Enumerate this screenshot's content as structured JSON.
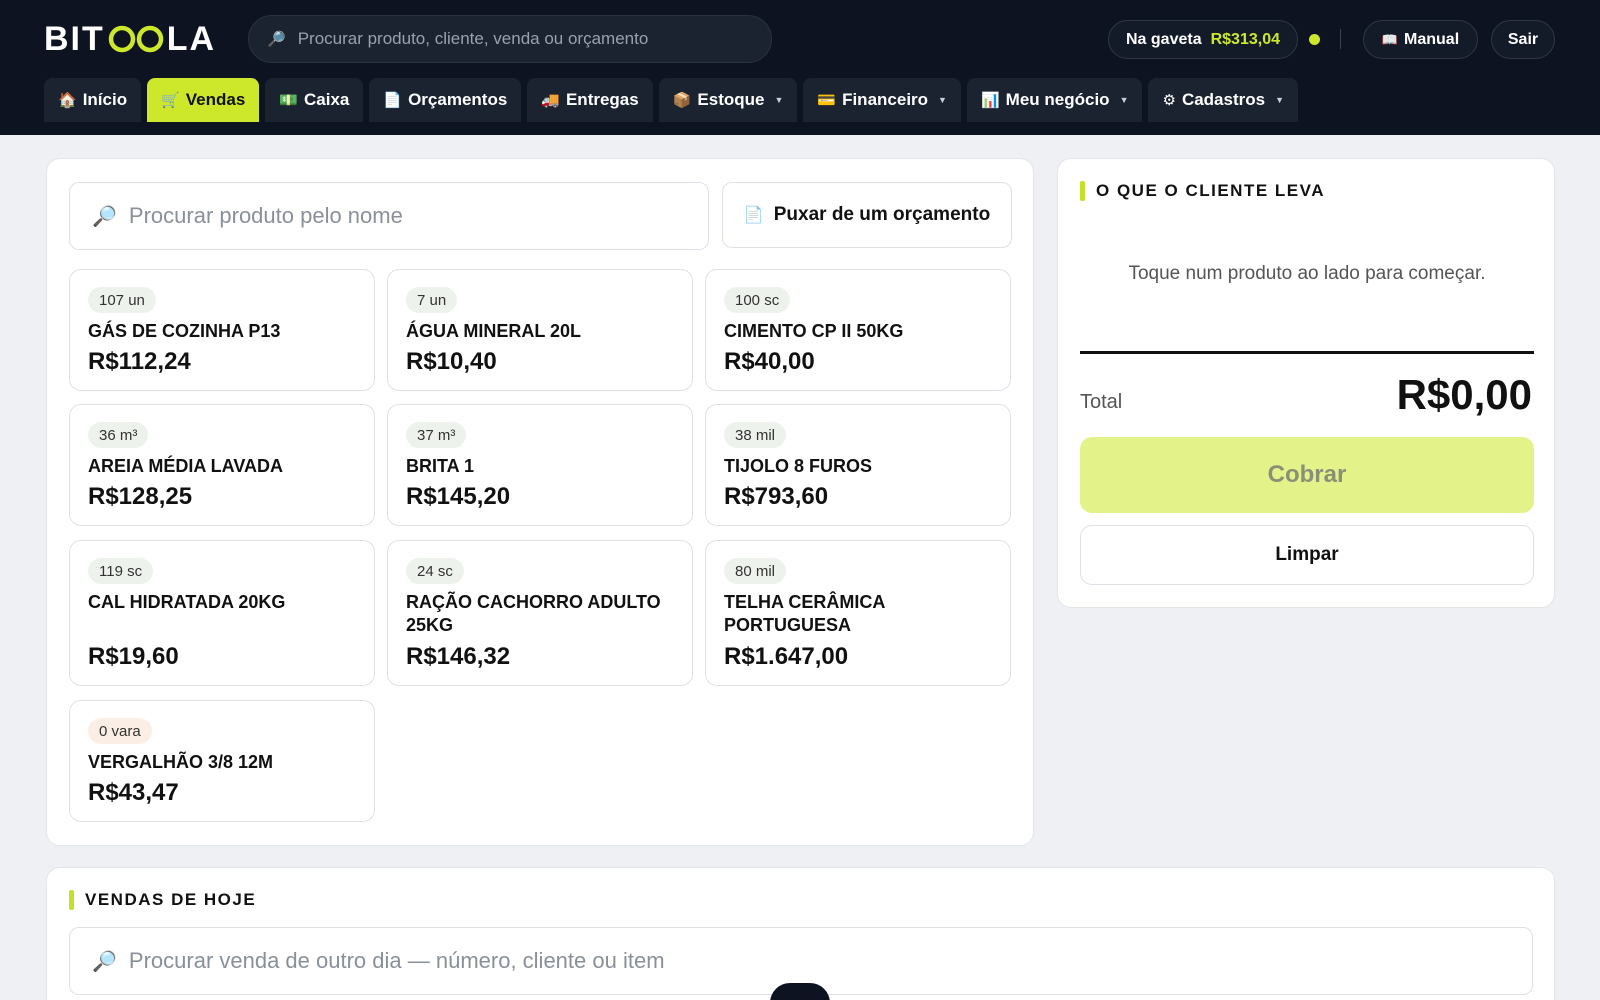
{
  "brand": {
    "name_left": "BIT",
    "name_right": "LA",
    "accent": "#cde82a",
    "header_bg": "#0d1320"
  },
  "header": {
    "search_placeholder": "Procurar produto, cliente, venda ou orçamento",
    "drawer_label": "Na gaveta",
    "drawer_amount": "R$313,04",
    "manual_label": "Manual",
    "logout_label": "Sair"
  },
  "nav": {
    "tabs": [
      {
        "icon": "🏠",
        "label": "Início"
      },
      {
        "icon": "🛒",
        "label": "Vendas"
      },
      {
        "icon": "💵",
        "label": "Caixa"
      },
      {
        "icon": "📄",
        "label": "Orçamentos"
      },
      {
        "icon": "🚚",
        "label": "Entregas"
      },
      {
        "icon": "📦",
        "label": "Estoque"
      },
      {
        "icon": "💳",
        "label": "Financeiro"
      },
      {
        "icon": "📊",
        "label": "Meu negócio"
      },
      {
        "icon": "⚙",
        "label": "Cadastros"
      }
    ],
    "active": "Vendas"
  },
  "products": {
    "search_placeholder": "Procurar produto pelo nome",
    "quote_button": "Puxar de um orçamento",
    "items": [
      {
        "stock": "107 un",
        "name": "GÁS DE COZINHA P13",
        "price": "R$112,24"
      },
      {
        "stock": "7 un",
        "name": "ÁGUA MINERAL 20L",
        "price": "R$10,40"
      },
      {
        "stock": "100 sc",
        "name": "CIMENTO CP II 50KG",
        "price": "R$40,00"
      },
      {
        "stock": "36 m³",
        "name": "AREIA MÉDIA LAVADA",
        "price": "R$128,25"
      },
      {
        "stock": "37 m³",
        "name": "BRITA 1",
        "price": "R$145,20"
      },
      {
        "stock": "38 mil",
        "name": "TIJOLO 8 FUROS",
        "price": "R$793,60"
      },
      {
        "stock": "119 sc",
        "name": "CAL HIDRATADA 20KG",
        "price": "R$19,60"
      },
      {
        "stock": "24 sc",
        "name": "RAÇÃO CACHORRO ADULTO 25KG",
        "price": "R$146,32"
      },
      {
        "stock": "80 mil",
        "name": "TELHA CERÂMICA PORTUGUESA",
        "price": "R$1.647,00"
      },
      {
        "stock": "0 vara",
        "name": "VERGALHÃO 3/8 12M",
        "price": "R$43,47"
      }
    ]
  },
  "cart": {
    "title": "O QUE O CLIENTE LEVA",
    "empty_message": "Toque num produto ao lado para começar.",
    "total_label": "Total",
    "total_value": "R$0,00",
    "charge_button": "Cobrar",
    "clear_button": "Limpar"
  },
  "today": {
    "title": "VENDAS DE HOJE",
    "search_placeholder": "Procurar venda de outro dia — número, cliente ou item"
  }
}
